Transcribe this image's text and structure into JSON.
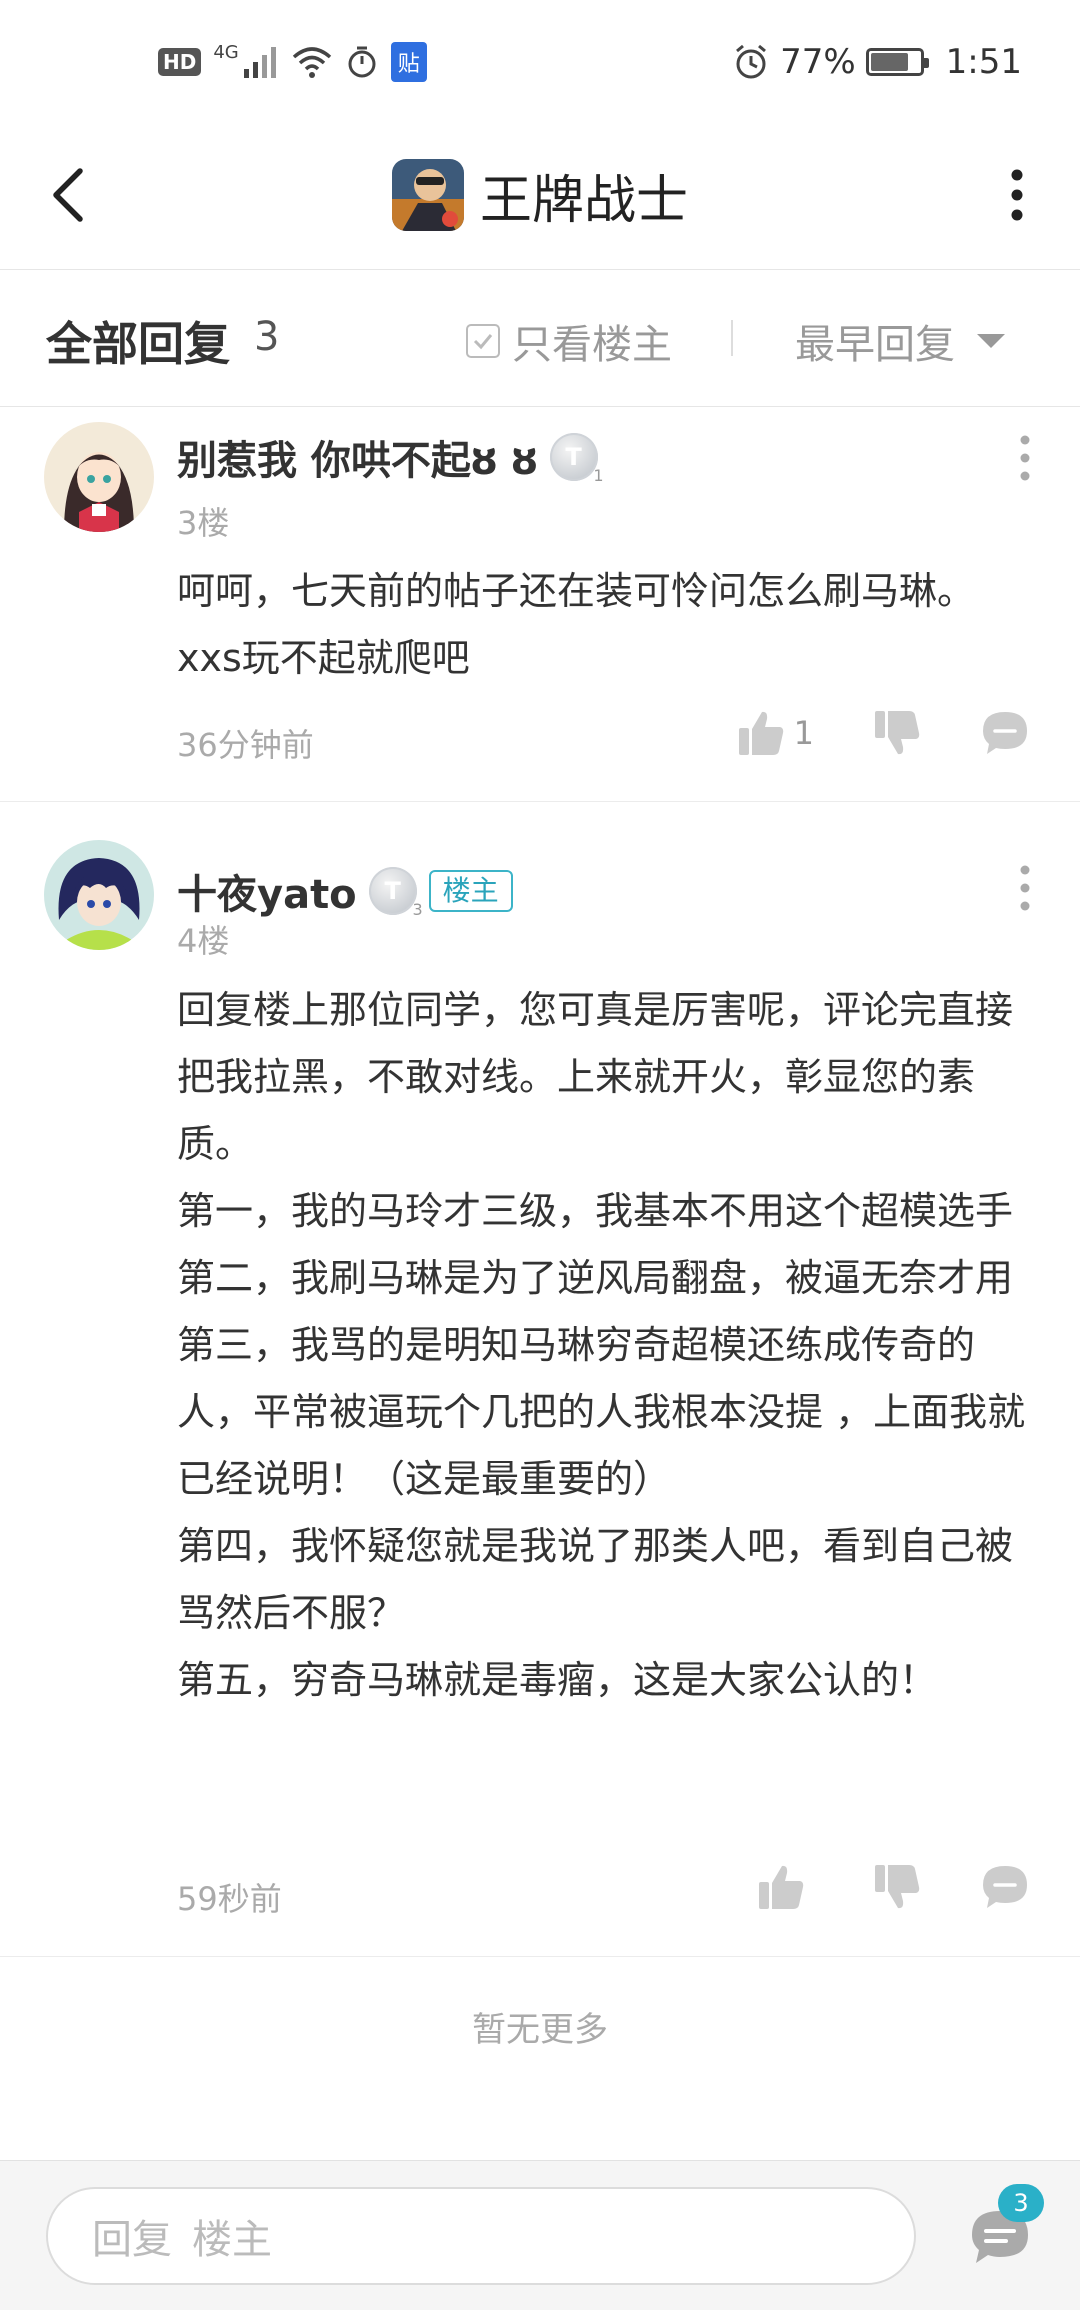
{
  "status_bar": {
    "left": {
      "hd": "HD",
      "network": "4G",
      "app_badge": "贴"
    },
    "right": {
      "battery_percent": "77%",
      "battery_level": 0.77,
      "time": "1:51"
    }
  },
  "header": {
    "title": "王牌战士"
  },
  "replies_bar": {
    "title": "全部回复",
    "count": "3",
    "only_op_label": "只看楼主",
    "sort_label": "最早回复"
  },
  "posts": [
    {
      "username": "别惹我 你哄不起ȣ ȣ",
      "level_letter": "T",
      "level_num": "1",
      "floor": "3楼",
      "content": [
        "呵呵，七天前的帖子还在装可怜问怎么刷马琳。xxs玩不起就爬吧"
      ],
      "time": "36分钟前",
      "like_count": "1"
    },
    {
      "username": "十夜yato",
      "level_letter": "T",
      "level_num": "3",
      "op_tag": "楼主",
      "floor": "4楼",
      "content": [
        "回复楼上那位同学，您可真是厉害呢，评论完直接把我拉黑，不敢对线。上来就开火，彰显您的素质。",
        "第一，我的马玲才三级，我基本不用这个超模选手",
        "第二，我刷马琳是为了逆风局翻盘，被逼无奈才用",
        "第三，我骂的是明知马琳穷奇超模还练成传奇的人，平常被逼玩个几把的人我根本没提 ，上面我就已经说明！（这是最重要的）",
        "第四，我怀疑您就是我说了那类人吧，看到自己被骂然后不服？",
        "第五，穷奇马琳就是毒瘤，这是大家公认的！"
      ],
      "time": "59秒前",
      "like_count": ""
    }
  ],
  "no_more": "暂无更多",
  "bottom_bar": {
    "reply_prefix": "回复",
    "reply_target": "楼主",
    "message_badge": "3"
  },
  "colors": {
    "accent": "#2ab0c8",
    "text_primary": "#333333",
    "text_secondary": "#aaaaaa"
  }
}
